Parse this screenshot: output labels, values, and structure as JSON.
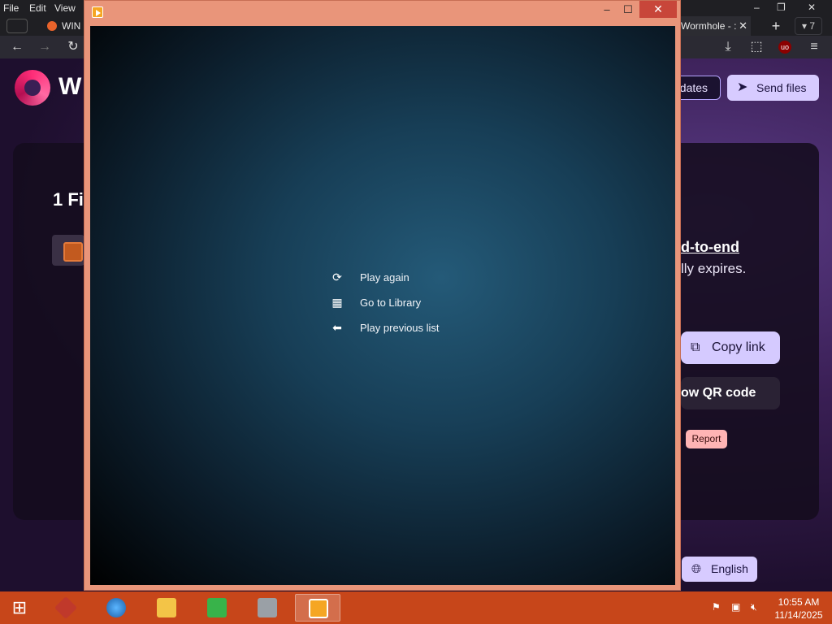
{
  "browser": {
    "menu": [
      "File",
      "Edit",
      "View"
    ],
    "tabs": [
      {
        "label": "WIN"
      },
      {
        "label": "Wormhole - :",
        "close": "✕"
      }
    ],
    "new_tab": "+",
    "tab_count": "7",
    "window_controls": {
      "minimize": "–",
      "restore": "❐",
      "close": "✕"
    }
  },
  "page": {
    "brand": "W",
    "updates_label": "pdates",
    "send_files_label": "Send files",
    "files_title": "1 Fi",
    "e2e_label": "d-to-end",
    "expires_text": "lly expires.",
    "copy_link_label": "Copy link",
    "qr_label": "ow QR code",
    "report_label": "Report",
    "language_label": "English"
  },
  "player": {
    "menu": [
      {
        "label": "Play again",
        "icon": "replay-icon"
      },
      {
        "label": "Go to Library",
        "icon": "library-icon"
      },
      {
        "label": "Play previous list",
        "icon": "back-arrow-icon"
      }
    ],
    "titlebar_controls": {
      "minimize": "–",
      "maximize": "☐",
      "close": "✕"
    }
  },
  "taskbar": {
    "time": "10:55 AM",
    "date": "11/14/2025",
    "apps": [
      {
        "name": "app-red-cube"
      },
      {
        "name": "app-browser"
      },
      {
        "name": "app-file-explorer"
      },
      {
        "name": "app-green-tablet"
      },
      {
        "name": "app-server"
      },
      {
        "name": "app-media-player"
      }
    ]
  },
  "colors": {
    "taskbar": "#c7461a",
    "player_frame": "#e9957a",
    "accent": "#d7cbff"
  }
}
